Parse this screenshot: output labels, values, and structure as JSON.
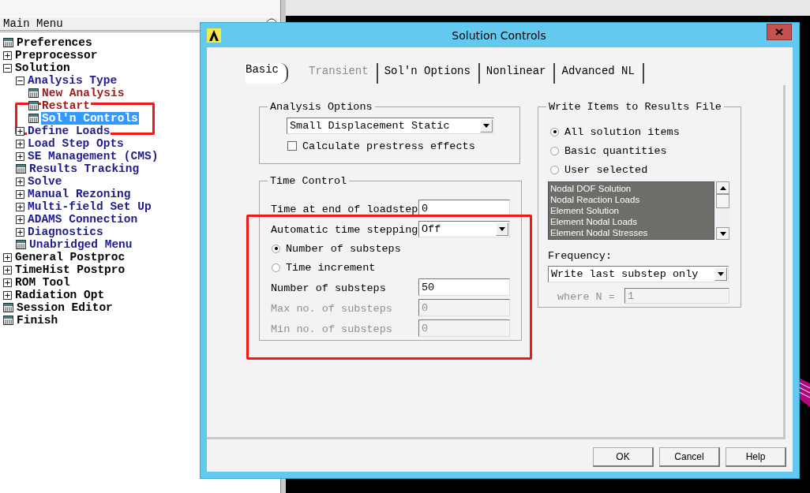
{
  "main_menu": {
    "title": "Main Menu",
    "items": [
      {
        "label": "Preferences",
        "kind": "action",
        "color": "#000000",
        "selected": false
      },
      {
        "label": "Preprocessor",
        "kind": "group",
        "expanded": false,
        "color": "#000000",
        "selected": false
      },
      {
        "label": "Solution",
        "kind": "group",
        "expanded": true,
        "color": "#000000",
        "selected": false,
        "children": [
          {
            "label": "Analysis Type",
            "kind": "group",
            "expanded": true,
            "color": "#1c1c8c",
            "selected": false,
            "children": [
              {
                "label": "New Analysis",
                "kind": "action",
                "color": "#a01c1c",
                "selected": false
              },
              {
                "label": "Restart",
                "kind": "action",
                "color": "#a01c1c",
                "selected": false
              },
              {
                "label": "Sol'n Controls",
                "kind": "action",
                "selected": true
              }
            ]
          },
          {
            "label": "Define Loads",
            "kind": "group",
            "expanded": false,
            "color": "#1c1c8c",
            "selected": false
          },
          {
            "label": "Load Step Opts",
            "kind": "group",
            "expanded": false,
            "color": "#1c1c8c",
            "selected": false
          },
          {
            "label": "SE Management (CMS)",
            "kind": "group",
            "expanded": false,
            "color": "#1c1c8c",
            "selected": false
          },
          {
            "label": "Results Tracking",
            "kind": "action",
            "color": "#1c1c8c",
            "selected": false
          },
          {
            "label": "Solve",
            "kind": "group",
            "expanded": false,
            "color": "#1c1c8c",
            "selected": false
          },
          {
            "label": "Manual Rezoning",
            "kind": "group",
            "expanded": false,
            "color": "#1c1c8c",
            "selected": false
          },
          {
            "label": "Multi-field Set Up",
            "kind": "group",
            "expanded": false,
            "color": "#1c1c8c",
            "selected": false
          },
          {
            "label": "ADAMS Connection",
            "kind": "group",
            "expanded": false,
            "color": "#1c1c8c",
            "selected": false
          },
          {
            "label": "Diagnostics",
            "kind": "group",
            "expanded": false,
            "color": "#1c1c8c",
            "selected": false
          },
          {
            "label": "Unabridged Menu",
            "kind": "action",
            "color": "#1c1c8c",
            "selected": false
          }
        ]
      },
      {
        "label": "General Postproc",
        "kind": "group",
        "expanded": false,
        "color": "#000000",
        "selected": false
      },
      {
        "label": "TimeHist Postpro",
        "kind": "group",
        "expanded": false,
        "color": "#000000",
        "selected": false
      },
      {
        "label": "ROM Tool",
        "kind": "group",
        "expanded": false,
        "color": "#000000",
        "selected": false
      },
      {
        "label": "Radiation Opt",
        "kind": "group",
        "expanded": false,
        "color": "#000000",
        "selected": false
      },
      {
        "label": "Session Editor",
        "kind": "action",
        "color": "#000000",
        "selected": false
      },
      {
        "label": "Finish",
        "kind": "action",
        "color": "#000000",
        "selected": false
      }
    ]
  },
  "dialog": {
    "title": "Solution Controls",
    "tabs": [
      {
        "label": "Basic",
        "selected": true,
        "disabled": false
      },
      {
        "label": "Transient",
        "selected": false,
        "disabled": true
      },
      {
        "label": "Sol'n Options",
        "selected": false,
        "disabled": false
      },
      {
        "label": "Nonlinear",
        "selected": false,
        "disabled": false
      },
      {
        "label": "Advanced NL",
        "selected": false,
        "disabled": false
      }
    ],
    "analysis_options": {
      "title": "Analysis Options",
      "analysis_type": "Small Displacement Static",
      "prestress": {
        "label": "Calculate prestress effects",
        "checked": false
      }
    },
    "time_control": {
      "title": "Time Control",
      "rows": [
        {
          "kind": "field",
          "label": "Time at end of loadstep",
          "value": "0",
          "disabled": false
        },
        {
          "kind": "dropdown",
          "label": "Automatic time stepping",
          "value": "Off"
        },
        {
          "kind": "radio",
          "label": "Number of substeps",
          "selected": true
        },
        {
          "kind": "radio",
          "label": "Time increment",
          "selected": false
        },
        {
          "kind": "field",
          "label": "Number of substeps",
          "value": "50",
          "disabled": false
        },
        {
          "kind": "field",
          "label": "Max no. of substeps",
          "value": "0",
          "disabled": true
        },
        {
          "kind": "field",
          "label": "Min no. of substeps",
          "value": "0",
          "disabled": true
        }
      ]
    },
    "write_items": {
      "title": "Write Items to Results File",
      "options": [
        {
          "label": "All solution items",
          "selected": true
        },
        {
          "label": "Basic quantities",
          "selected": false
        },
        {
          "label": "User selected",
          "selected": false
        }
      ],
      "items": [
        "Nodal DOF Solution",
        "Nodal Reaction Loads",
        "Element Solution",
        "Element Nodal Loads",
        "Element Nodal Stresses"
      ],
      "frequency_label": "Frequency:",
      "frequency": "Write last substep only",
      "where_n": {
        "label": "where N =",
        "value": "1",
        "disabled": true
      }
    },
    "buttons": [
      "OK",
      "Cancel",
      "Help"
    ]
  }
}
